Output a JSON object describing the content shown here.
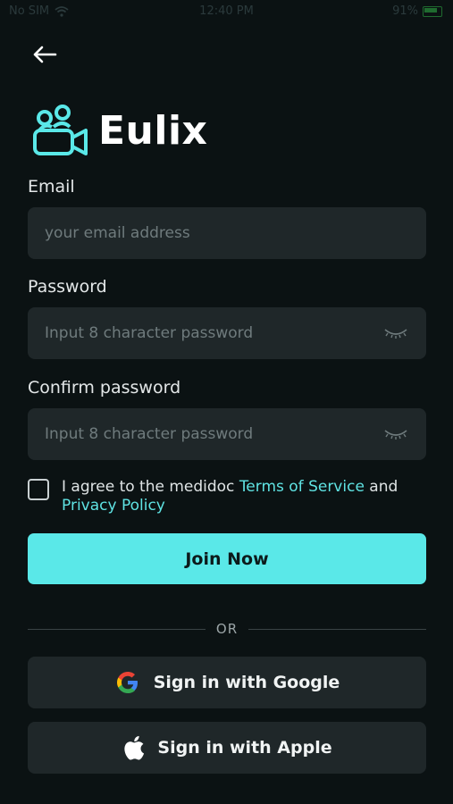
{
  "status_bar": {
    "carrier": "No SIM",
    "time": "12:40 PM",
    "battery": "91%"
  },
  "brand": {
    "name": "Eulix",
    "accent": "#5ae8e8"
  },
  "form": {
    "email": {
      "label": "Email",
      "placeholder": "your email address",
      "value": ""
    },
    "password": {
      "label": "Password",
      "placeholder": "Input 8 character password",
      "value": ""
    },
    "confirm": {
      "label": "Confirm password",
      "placeholder": "Input 8 character password",
      "value": ""
    }
  },
  "agreement": {
    "prefix": "I agree to the medidoc ",
    "terms": "Terms of Service",
    "and": " and ",
    "privacy": "Privacy Policy",
    "checked": false
  },
  "join_button": "Join Now",
  "divider_text": "OR",
  "social": {
    "google": "Sign in with Google",
    "apple": "Sign in with Apple"
  },
  "icons": [
    "back-arrow-icon",
    "wifi-icon",
    "battery-icon",
    "eye-closed-icon",
    "google-icon",
    "apple-icon",
    "checkbox"
  ]
}
